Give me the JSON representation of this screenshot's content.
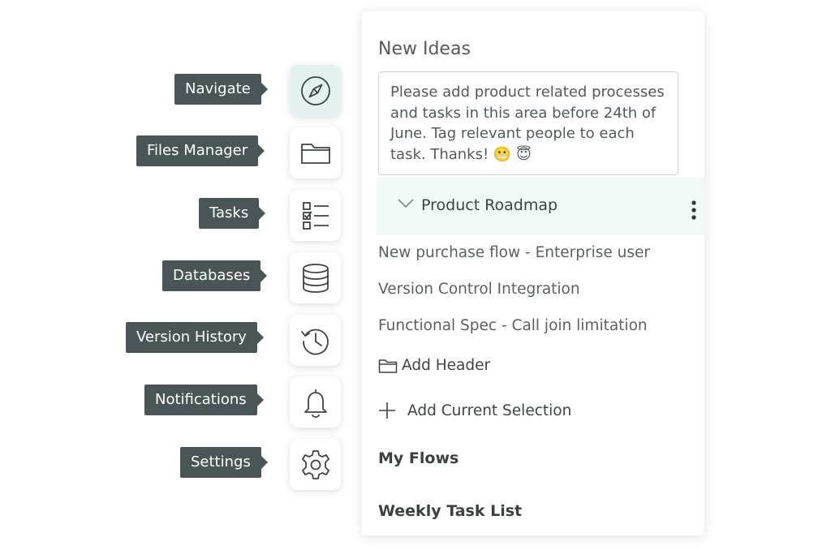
{
  "sidebar": {
    "items": [
      {
        "label": "Navigate",
        "icon": "compass-icon",
        "active": true
      },
      {
        "label": "Files Manager",
        "icon": "folder-icon",
        "active": false
      },
      {
        "label": "Tasks",
        "icon": "checklist-icon",
        "active": false
      },
      {
        "label": "Databases",
        "icon": "database-icon",
        "active": false
      },
      {
        "label": "Version History",
        "icon": "history-icon",
        "active": false
      },
      {
        "label": "Notifications",
        "icon": "bell-icon",
        "active": false
      },
      {
        "label": "Settings",
        "icon": "gear-icon",
        "active": false
      }
    ]
  },
  "panel": {
    "title": "New Ideas",
    "note": "Please add product related processes and tasks in this area before 24th of June. Tag relevant people to each task. Thanks! 😬 😇",
    "section": {
      "title": "Product Roadmap",
      "items": [
        "New purchase flow - Enterprise user",
        "Version Control Integration",
        "Functional Spec - Call join limitation"
      ]
    },
    "add_header": "Add Header",
    "add_selection": "Add Current Selection",
    "my_flows": "My Flows",
    "weekly_task_list": "Weekly Task List"
  },
  "colors": {
    "tooltip_bg": "#4a5558",
    "active_bg": "#e3f2f0",
    "section_bg": "#f1f8f6",
    "icon_stroke": "#3d4446"
  }
}
